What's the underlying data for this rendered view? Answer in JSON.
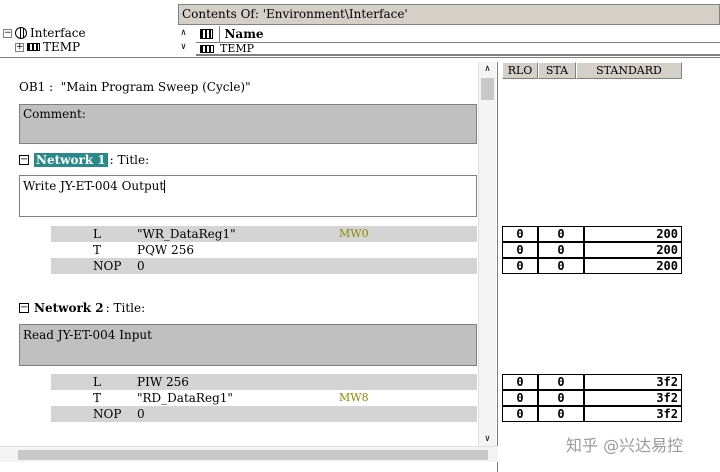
{
  "top": {
    "contents_label": "Contents Of: 'Environment\\Interface'",
    "tree": [
      {
        "toggle": "−",
        "label": "Interface"
      },
      {
        "toggle": "+",
        "label": "TEMP"
      }
    ],
    "name_header": "Name",
    "name_row": "TEMP"
  },
  "editor": {
    "ob_title": "OB1 :  \"Main Program Sweep (Cycle)\"",
    "ob_comment": "Comment:",
    "networks": [
      {
        "toggle": "−",
        "label": "Network 1",
        "title_label": ": Title:",
        "title_text": "Write JY-ET-004 Output",
        "statements": [
          {
            "op": "L",
            "arg": "\"WR_DataReg1\"",
            "sym": "MW0"
          },
          {
            "op": "T",
            "arg": "PQW  256",
            "sym": ""
          },
          {
            "op": "NOP",
            "arg": "0",
            "sym": ""
          }
        ]
      },
      {
        "toggle": "−",
        "label": "Network 2",
        "title_label": ": Title:",
        "title_text": "Read JY-ET-004 Input",
        "statements": [
          {
            "op": "L",
            "arg": "PIW  256",
            "sym": ""
          },
          {
            "op": "T",
            "arg": "\"RD_DataReg1\"",
            "sym": "MW8"
          },
          {
            "op": "NOP",
            "arg": "0",
            "sym": ""
          }
        ]
      }
    ]
  },
  "status": {
    "headers": {
      "rlo": "RLO",
      "sta": "STA",
      "standard": "STANDARD"
    },
    "network1_rows": [
      {
        "rlo": "0",
        "sta": "0",
        "standard": "200"
      },
      {
        "rlo": "0",
        "sta": "0",
        "standard": "200"
      },
      {
        "rlo": "0",
        "sta": "0",
        "standard": "200"
      }
    ],
    "network2_rows": [
      {
        "rlo": "0",
        "sta": "0",
        "standard": "3f2"
      },
      {
        "rlo": "0",
        "sta": "0",
        "standard": "3f2"
      },
      {
        "rlo": "0",
        "sta": "0",
        "standard": "3f2"
      }
    ]
  },
  "watermark": "知乎 @兴达易控",
  "colors": {
    "network_highlight": "#2a8a8a",
    "symbol_address": "#8a8a00",
    "comment_bg": "#c0c0c0",
    "row_shade": "#d4d4d4"
  }
}
